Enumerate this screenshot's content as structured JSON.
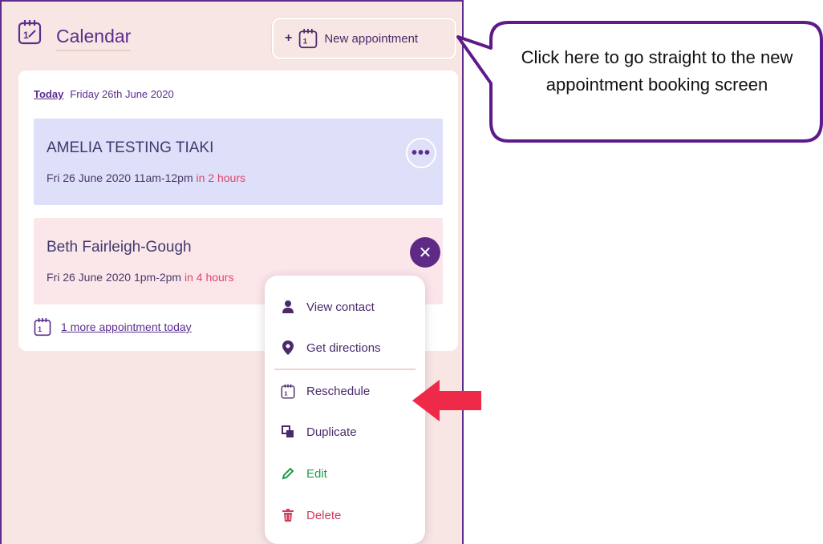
{
  "header": {
    "title": "Calendar",
    "new_appointment_plus": "+",
    "new_appointment_label": "New appointment"
  },
  "today": {
    "link": "Today",
    "date": "Friday 26th June 2020"
  },
  "appointments": [
    {
      "name": "AMELIA TESTING TIAKI",
      "time": "Fri 26 June 2020 11am-12pm",
      "relative": "in 2 hours",
      "action": "•••"
    },
    {
      "name": "Beth Fairleigh-Gough",
      "time": "Fri 26 June 2020 1pm-2pm",
      "relative": "in 4 hours",
      "action": "✕"
    }
  ],
  "more_today": "1 more appointment today",
  "menu": {
    "view_contact": "View contact",
    "get_directions": "Get directions",
    "reschedule": "Reschedule",
    "duplicate": "Duplicate",
    "edit": "Edit",
    "delete": "Delete"
  },
  "callout": {
    "text": "Click here to go straight to the new appointment booking screen"
  },
  "colors": {
    "brand_purple": "#5b2d8e",
    "panel_bg": "#f8e6e4",
    "appt_blue": "#dedff8",
    "appt_pink": "#fbe6ea",
    "relative_time": "#e0456b",
    "edit_green": "#1e9c4a",
    "delete_red": "#d23b58",
    "arrow_red": "#ee2a48"
  },
  "icons": {
    "header": "calendar-icon",
    "new_appointment": "calendar-icon",
    "more_today": "calendar-icon",
    "view_contact": "person-icon",
    "get_directions": "map-pin-icon",
    "reschedule": "calendar-icon",
    "duplicate": "duplicate-icon",
    "edit": "pencil-icon",
    "delete": "trash-icon"
  }
}
